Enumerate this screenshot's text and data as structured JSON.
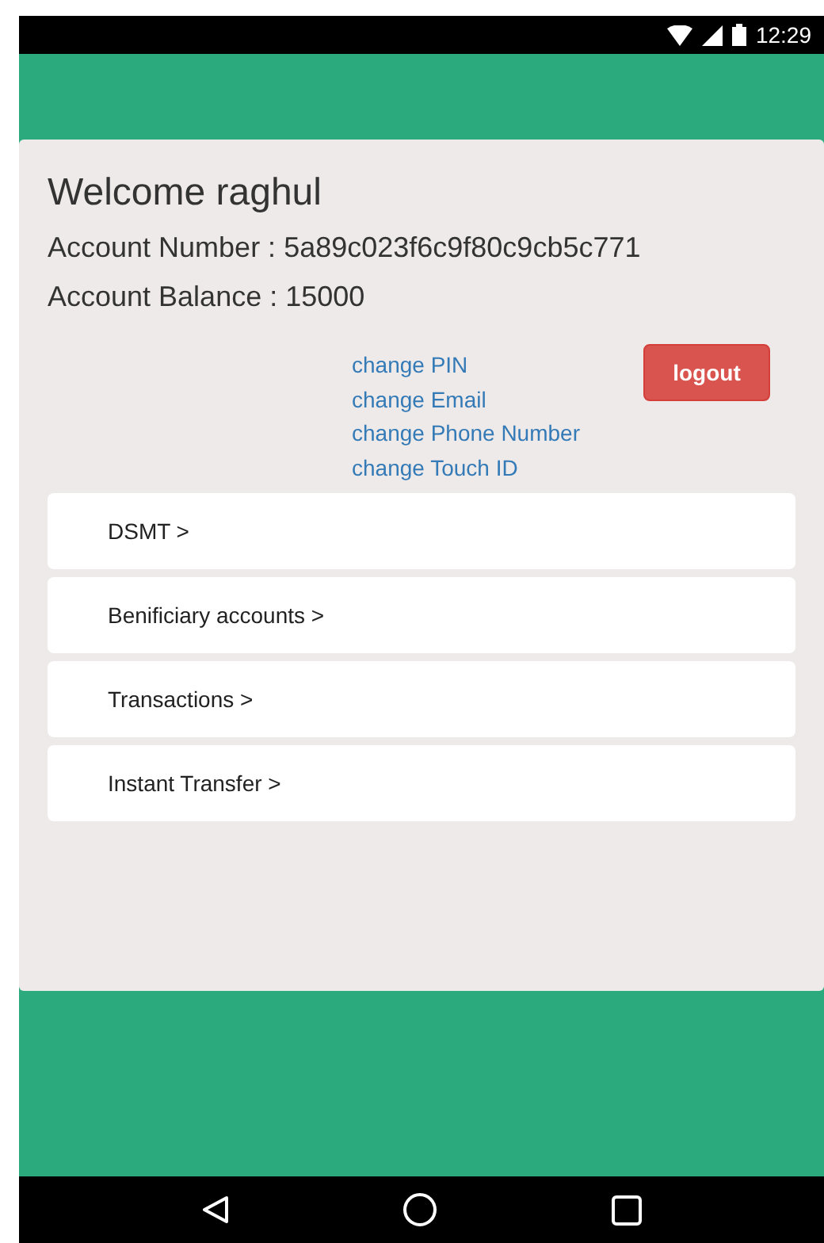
{
  "status_bar": {
    "time": "12:29"
  },
  "welcome": "Welcome raghul",
  "account_number": "Account Number : 5a89c023f6c9f80c9cb5c771",
  "account_balance": "Account Balance : 15000",
  "links": [
    "change PIN",
    "change Email",
    "change Phone Number",
    "change Touch ID"
  ],
  "logout_button": "logout",
  "menu_items": [
    "DSMT >",
    "Benificiary accounts >",
    "Transactions >",
    "Instant Transfer >"
  ]
}
